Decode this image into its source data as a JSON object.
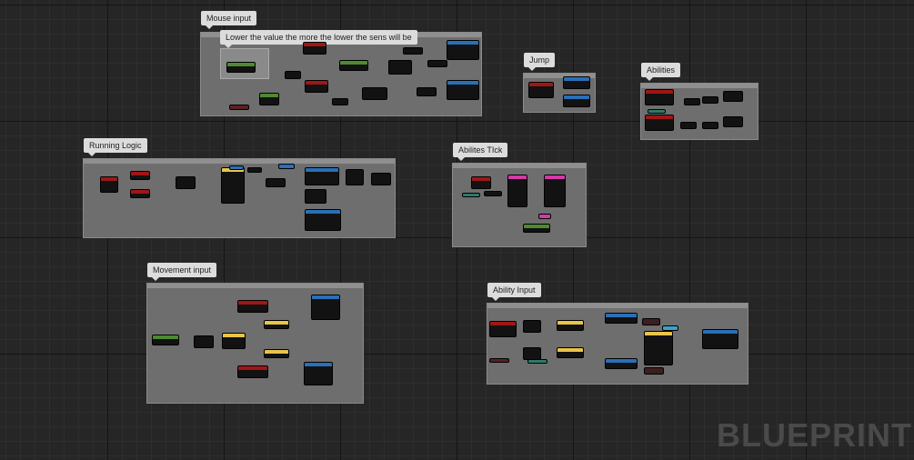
{
  "comments": [
    {
      "id": "mouse-input",
      "label": "Mouse input"
    },
    {
      "id": "jump",
      "label": "Jump"
    },
    {
      "id": "abilities",
      "label": "Abilities"
    },
    {
      "id": "running-logic",
      "label": "Running Logic"
    },
    {
      "id": "abilities-tick",
      "label": "Abilites TIck"
    },
    {
      "id": "movement-input",
      "label": "Movement input"
    },
    {
      "id": "ability-input",
      "label": "Ability Input"
    }
  ],
  "note": {
    "text": "Lower the value the more the lower the sens will be"
  },
  "watermark": "BLUEPRINT",
  "colors": {
    "exec": "#ffffff",
    "float": "#9ad14a",
    "bool": "#a01616",
    "struct": "#2a6fb8",
    "vector": "#e8c44a",
    "object": "#3aa4c8",
    "enum": "#2f7a6a",
    "byte": "#d23aa8"
  }
}
